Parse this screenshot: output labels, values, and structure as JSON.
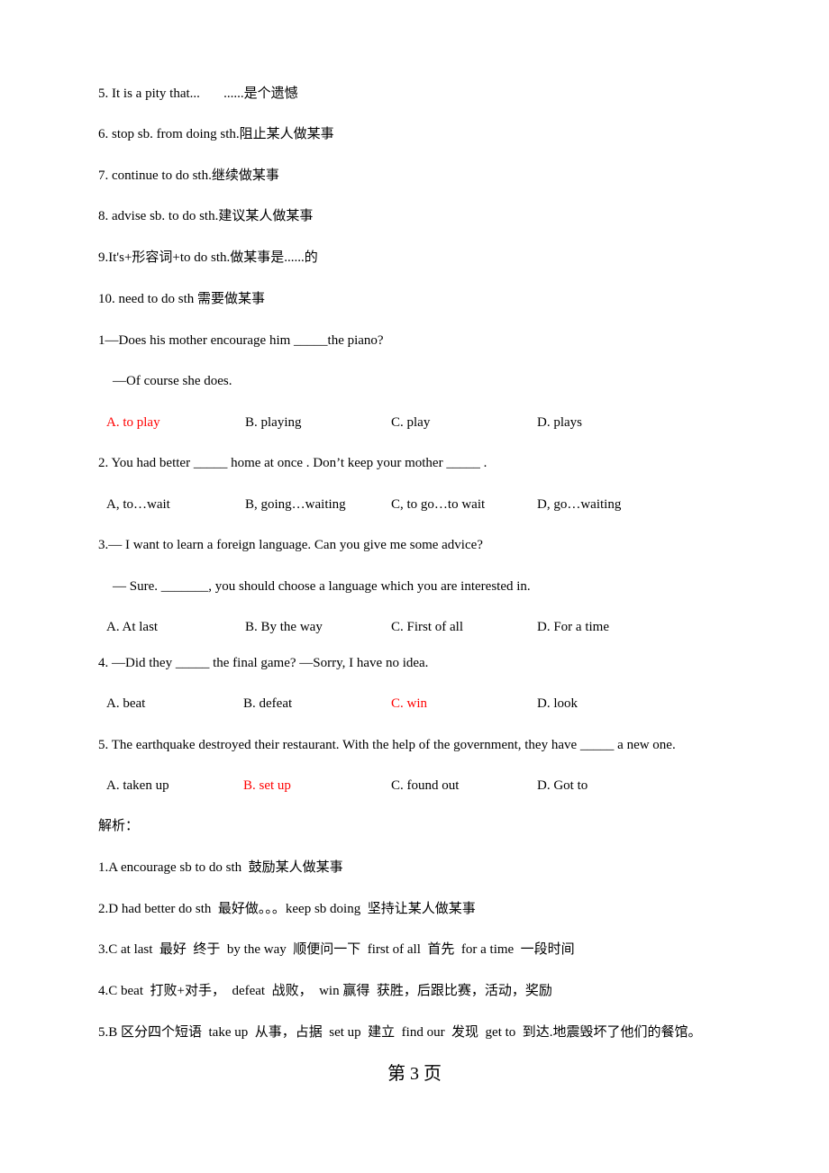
{
  "phrases": [
    "5. It is a pity that...       ......是个遗憾",
    "6. stop sb. from doing sth.阻止某人做某事",
    "7. continue to do sth.继续做某事",
    "8. advise sb. to do sth.建议某人做某事",
    "9.It's+形容词+to do sth.做某事是......的",
    "10. need to do sth 需要做某事"
  ],
  "questions": [
    {
      "stem": "1—Does his mother encourage him _____the piano?",
      "stem2": "—Of course she does.",
      "options": [
        "A. to play",
        "B. playing",
        "C. play",
        "D. plays"
      ],
      "answer_index": 0
    },
    {
      "stem": "2. You had better _____ home at once . Don’t keep your mother _____ .",
      "options": [
        "A, to…wait",
        "B, going…waiting",
        "C, to go…to wait",
        "D, go…waiting"
      ],
      "answer_index": null
    },
    {
      "stem": "3.— I want to learn a foreign language. Can you give me some advice?",
      "stem2": "— Sure. _______, you should choose a language which you are interested in.",
      "options": [
        "A. At last",
        "B. By the way",
        "C. First of all",
        "D. For a time"
      ],
      "answer_index": null
    },
    {
      "stem": "4. —Did they _____ the final game? —Sorry, I have no idea.",
      "options": [
        "A. beat",
        "B. defeat",
        "C. win",
        "D. look"
      ],
      "answer_index": 2
    },
    {
      "stem": "5. The earthquake destroyed their restaurant. With the help of the government, they have _____ a new one.",
      "options": [
        "A. taken up",
        "B. set up",
        "C. found out",
        "D. Got to"
      ],
      "answer_index": 1
    }
  ],
  "analysis": {
    "heading": "解析：",
    "items": [
      "1.A encourage sb to do sth  鼓励某人做某事",
      "2.D had better do sth  最好做。。。keep sb doing  坚持让某人做某事",
      "3.C at last  最好  终于  by the way  顺便问一下  first of all  首先  for a time  一段时间",
      "4.C beat  打败+对手，  defeat  战败，  win 赢得  获胜，后跟比赛，活动，奖励",
      "5.B 区分四个短语  take up  从事，占据  set up  建立  find our  发现  get to  到达.地震毁坏了他们的餐馆。"
    ]
  },
  "footer": {
    "page_label": "第 3 页"
  },
  "colors": {
    "answer_highlight": "#ff0000",
    "text": "#000000"
  }
}
